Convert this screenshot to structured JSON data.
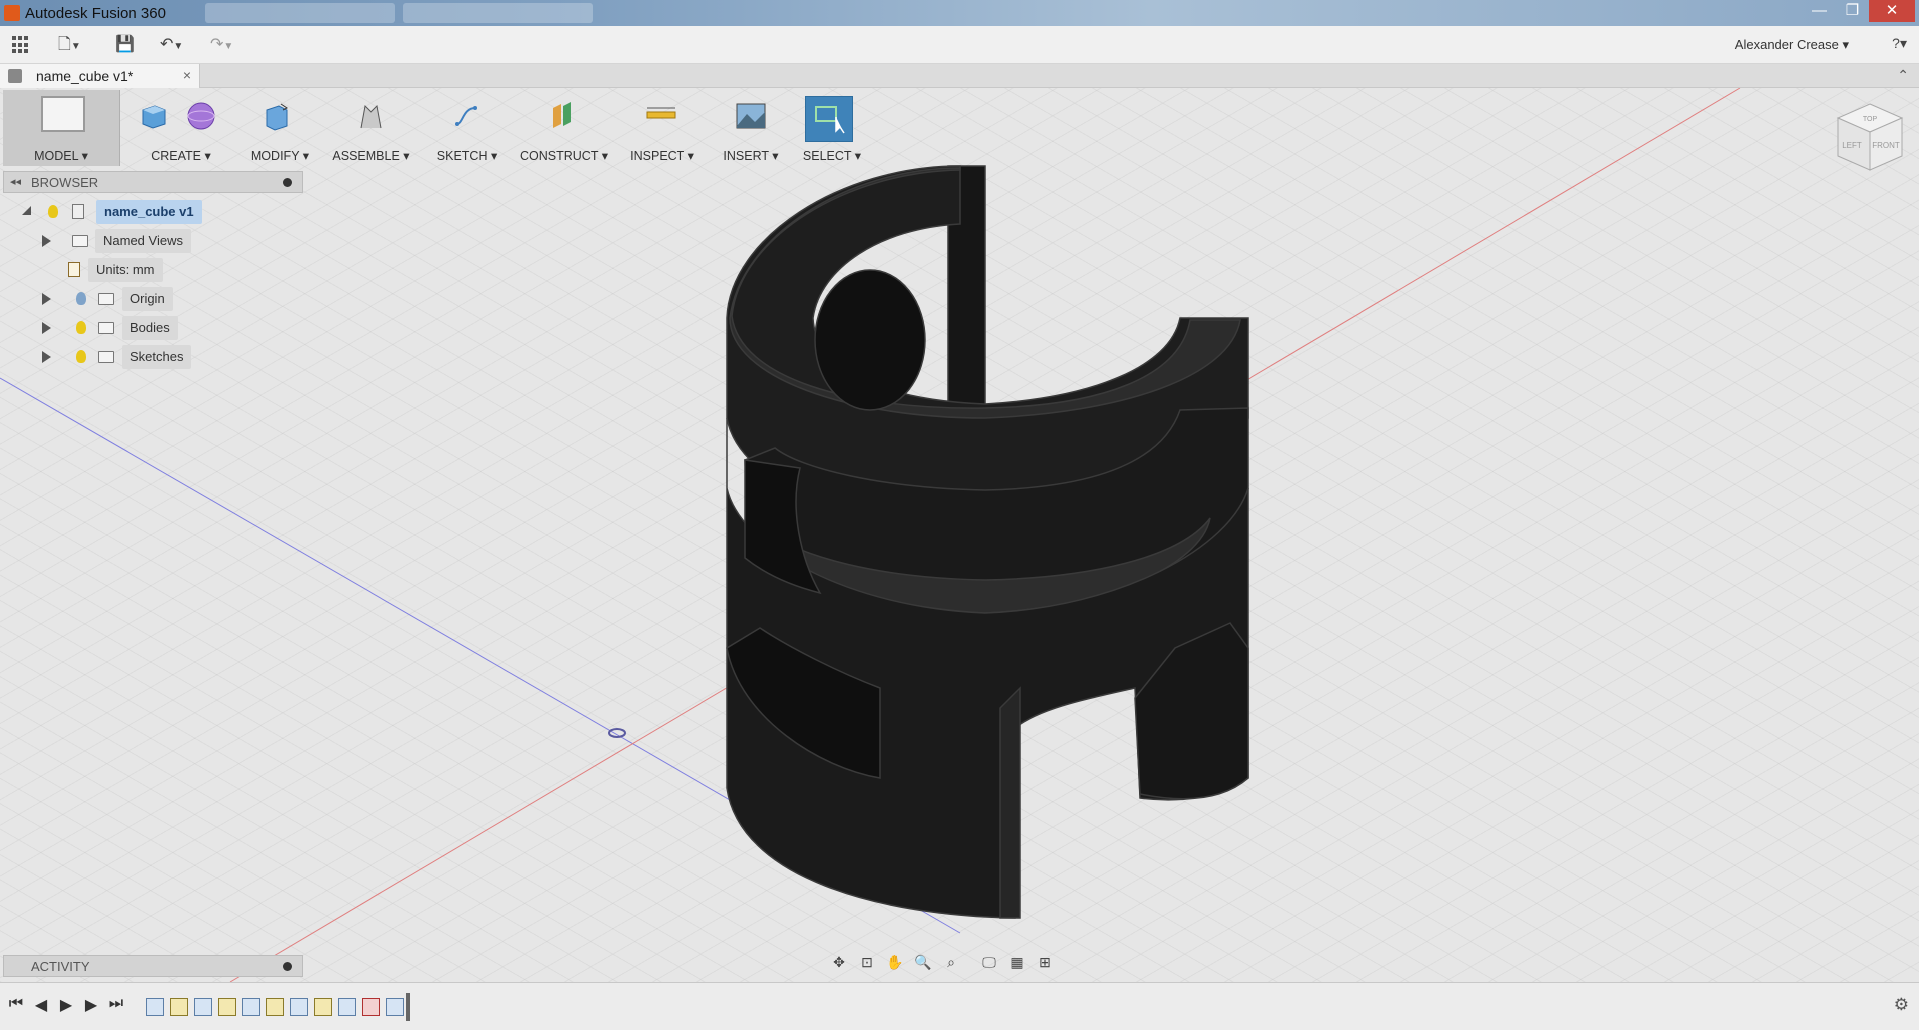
{
  "window": {
    "title": "Autodesk Fusion 360"
  },
  "qat": {
    "undo": "↶",
    "redo": "↷",
    "save": "💾",
    "user": "Alexander Crease ▾",
    "help": "?▾"
  },
  "doc_tab": {
    "label": "name_cube v1*",
    "close": "×"
  },
  "ribbon": {
    "model": "MODEL ▾",
    "create": "CREATE ▾",
    "modify": "MODIFY ▾",
    "assemble": "ASSEMBLE ▾",
    "sketch": "SKETCH ▾",
    "construct": "CONSTRUCT ▾",
    "inspect": "INSPECT ▾",
    "insert": "INSERT ▾",
    "select": "SELECT ▾"
  },
  "browser": {
    "title": "BROWSER",
    "collapse": "◂◂",
    "items": [
      {
        "label": "name_cube v1"
      },
      {
        "label": "Named Views"
      },
      {
        "label": "Units: mm"
      },
      {
        "label": "Origin"
      },
      {
        "label": "Bodies"
      },
      {
        "label": "Sketches"
      }
    ]
  },
  "activity": {
    "title": "ACTIVITY"
  },
  "viewcube": {
    "top": "TOP",
    "left": "LEFT",
    "front": "FRONT"
  },
  "colors": {
    "accent": "#3f83b9",
    "model": "#1f1f1f",
    "browser_selected": "#b9d3ee"
  }
}
